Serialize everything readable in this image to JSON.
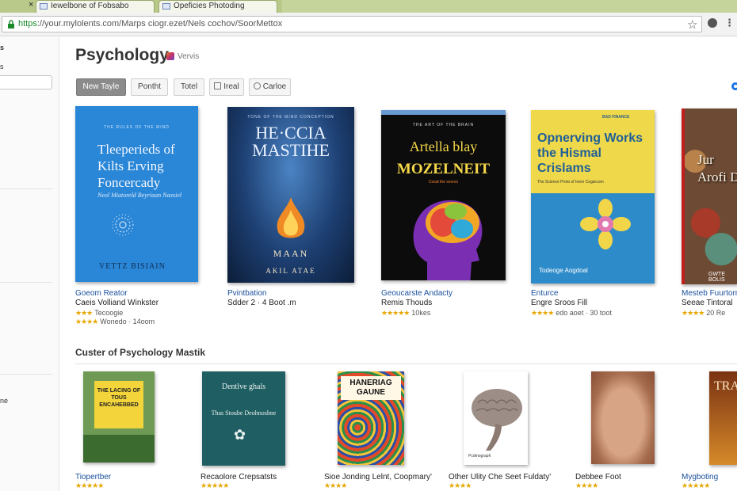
{
  "browser": {
    "tabs": [
      {
        "label": "Iewelbone of Fobsabo"
      },
      {
        "label": "Opeficies Photoding"
      }
    ],
    "tab_close_glyph": "×",
    "url_scheme": "https",
    "url_rest": "://your.mylolents.com/Marps ciogr.ezet/Nels cochov/SoorMettox",
    "icons": {
      "lock": "lock-icon",
      "star": "bookmark-star-icon",
      "extension": "extension-icon",
      "menu": "menu-icon"
    }
  },
  "sidebar": {
    "top_glyph": "s",
    "text1": "s",
    "bottom_text": "ne"
  },
  "page": {
    "title": "Psychology",
    "badge_text": "Vervis"
  },
  "filters": [
    {
      "label": "New Tayle",
      "active": true
    },
    {
      "label": "Pontht"
    },
    {
      "label": "Totel"
    },
    {
      "label": "Ireal"
    },
    {
      "label": "Carloe"
    }
  ],
  "books": [
    {
      "cover_top": "THE RULES OF THE MIND",
      "cover_title": "Tleeperieds of Kilts Erving Foncercady",
      "cover_sub": "Neol Miatoreld Beyriaan Naxsiel",
      "cover_author": "VETTZ BISIAIN",
      "title": "Goeom Reator",
      "author": "Caeis Volliand Winkster",
      "rating_text": "Tecoogie",
      "meta": "Wonedo · 14oom"
    },
    {
      "cover_top": "TONE OF THE MIND CONCEPTION",
      "cover_title": "HE·CCIA MASTIHE",
      "cover_sub": "MAAN",
      "cover_author": "AKIL ATAE",
      "title": "Pvintbation",
      "author": "Sdder 2 · 4 Boot .m",
      "meta": ""
    },
    {
      "cover_top": "THE ART OF THE BRAIN",
      "cover_title_1": "Artella blay",
      "cover_title_2": "MOZELNEIT",
      "cover_sub": "Cosal the sexors",
      "title": "Geoucarste Andacty",
      "author": "Remis Thouds",
      "meta": "10kes"
    },
    {
      "cover_top": "BAD FINANCE",
      "cover_title": "Opnerving Works the Hismal Crislams",
      "cover_sub": "The Science Proto of Inem Cogarcom",
      "cover_author": "Todeoge Aogdoal",
      "title": "Enturce",
      "author": "Engre Sroos Fill",
      "meta": "edo aoet · 30 toot"
    },
    {
      "cover_title": "Jur Arofi Di",
      "cover_author": "GWTE BOLIS",
      "title": "Mesteb Fuurtorn",
      "author": "Seeae Tintoral",
      "meta": "20 Re"
    }
  ],
  "section2": {
    "title": "Custer of Psychology Mastik",
    "books": [
      {
        "title": "Tiopertber",
        "cover_text": "THE LACING OF TOUS ENCAHEBBED"
      },
      {
        "title": "Recaolore Crepsatsts",
        "cover_text_1": "Dentlve ghals",
        "cover_text_2": "Thas Stoube Deohnoshne"
      },
      {
        "title": "Sioe Jonding Lelnt, Coopmary'",
        "cover_text": "HANERIAG GAUNE"
      },
      {
        "title": "Other Ulity Che Seet Fuldaty'",
        "cover_text": "Pcdmograph"
      },
      {
        "title": "Debbee Foot"
      },
      {
        "title": "Mygboting",
        "cover_text": "TRA"
      }
    ]
  }
}
